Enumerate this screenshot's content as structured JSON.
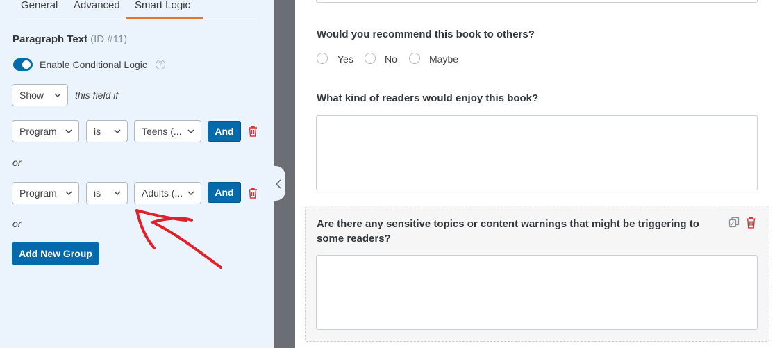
{
  "tabs": [
    {
      "label": "General"
    },
    {
      "label": "Advanced"
    },
    {
      "label": "Smart Logic"
    }
  ],
  "field": {
    "title": "Paragraph Text",
    "id_text": "(ID #11)"
  },
  "conditional": {
    "label": "Enable Conditional Logic",
    "enabled": true,
    "help": "?"
  },
  "show": {
    "value": "Show",
    "suffix": "this field if"
  },
  "groups": [
    {
      "field": "Program",
      "operator": "is",
      "value": "Teens (...",
      "and_label": "And"
    },
    {
      "field": "Program",
      "operator": "is",
      "value": "Adults (...",
      "and_label": "And"
    }
  ],
  "or_label": "or",
  "add_group_label": "Add New Group",
  "preview": {
    "q1": {
      "label": "Would you recommend this book to others?",
      "options": [
        "Yes",
        "No",
        "Maybe"
      ]
    },
    "q2": {
      "label": "What kind of readers would enjoy this book?"
    },
    "q3": {
      "label": "Are there any sensitive topics or content warnings that might be triggering to some readers?"
    }
  },
  "colors": {
    "accent": "#056aab",
    "tab_active": "#e27730",
    "annotation_arrow": "#e0202a",
    "trash": "#d63638"
  },
  "icons": [
    "help-icon",
    "chevron-down-icon",
    "trash-icon",
    "chevron-left-icon",
    "duplicate-icon",
    "arrow-annotation"
  ]
}
